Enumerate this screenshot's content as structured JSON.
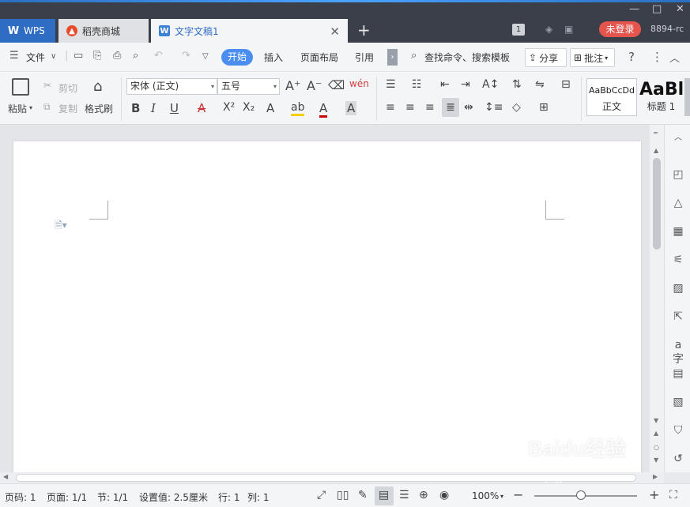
{
  "titlebar": {
    "tabs": [
      {
        "label": "WPS",
        "icon": "wps-logo-icon"
      },
      {
        "label": "稻壳商城",
        "icon": "daoke-icon"
      },
      {
        "label": "文字文稿1",
        "icon": "writer-doc-icon"
      }
    ],
    "new_tab_symbol": "+",
    "tab_count": "1",
    "login_label": "未登录",
    "user_id": "8894-rc",
    "window_controls": [
      "—",
      "□",
      "✕"
    ]
  },
  "menubar": {
    "file_label": "文件",
    "tabs": [
      "开始",
      "插入",
      "页面布局",
      "引用"
    ],
    "active_tab": "开始",
    "search_label": "查找命令、搜索模板",
    "share_label": "分享",
    "comment_label": "批注",
    "help_symbol": "?",
    "more_symbol": "⋮"
  },
  "ribbon": {
    "clipboard": {
      "paste": "粘贴",
      "cut": "剪切",
      "copy": "复制",
      "format_painter": "格式刷"
    },
    "font": {
      "family": "宋体 (正文)",
      "size": "五号"
    },
    "styles": [
      {
        "preview": "AaBbCcDd",
        "name": "正文"
      },
      {
        "preview": "AaBl",
        "name": "标题 1"
      }
    ]
  },
  "statusbar": {
    "page_number": "页码: 1",
    "pages": "页面: 1/1",
    "section": "节: 1/1",
    "setting": "设置值: 2.5厘米",
    "line": "行: 1",
    "column": "列: 1",
    "zoom": "100%",
    "zoom_level": 0.45
  },
  "watermark": {
    "text": "Baidu经验",
    "sub": "jingyan.baidu.com"
  },
  "colors": {
    "accent": "#4a8ff0",
    "titlebar": "#3a3f4a",
    "login": "#e5554e"
  }
}
